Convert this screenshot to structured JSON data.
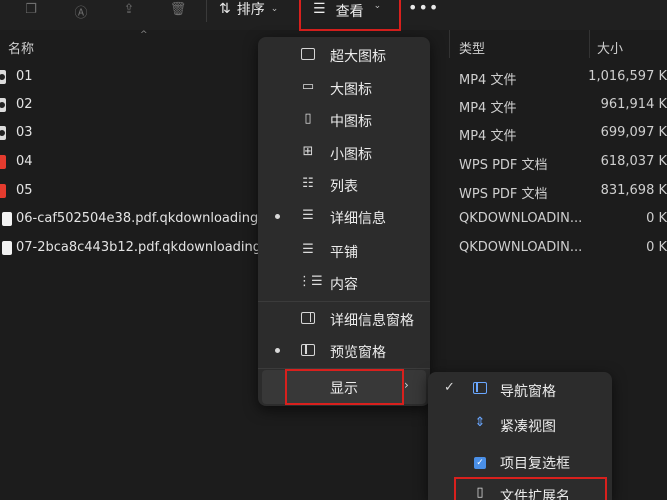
{
  "toolbar": {
    "sort_label": "排序",
    "view_label": "查看",
    "more": "•••"
  },
  "columns": {
    "name": "名称",
    "type": "类型",
    "size": "大小"
  },
  "files": [
    {
      "name": "01",
      "type": "MP4 文件",
      "size": "1,016,597 K",
      "icon": "video"
    },
    {
      "name": "02",
      "type": "MP4 文件",
      "size": "961,914 K",
      "icon": "video"
    },
    {
      "name": "03",
      "type": "MP4 文件",
      "size": "699,097 K",
      "icon": "video"
    },
    {
      "name": "04",
      "type": "WPS PDF 文档",
      "size": "618,037 K",
      "icon": "pdf"
    },
    {
      "name": "05",
      "type": "WPS PDF 文档",
      "size": "831,698 K",
      "icon": "pdf"
    },
    {
      "name": "06-caf502504e38.pdf.qkdownloading",
      "type": "QKDOWNLOADIN...",
      "size": "0 K",
      "icon": "blank"
    },
    {
      "name": "07-2bca8c443b12.pdf.qkdownloading",
      "type": "QKDOWNLOADIN...",
      "size": "0 K",
      "icon": "blank"
    }
  ],
  "view_menu": {
    "items": [
      {
        "label": "超大图标",
        "icon": "xl-icons-icon",
        "selected": false
      },
      {
        "label": "大图标",
        "icon": "large-icons-icon",
        "selected": false
      },
      {
        "label": "中图标",
        "icon": "medium-icons-icon",
        "selected": false
      },
      {
        "label": "小图标",
        "icon": "small-icons-icon",
        "selected": false
      },
      {
        "label": "列表",
        "icon": "list-icon",
        "selected": false
      },
      {
        "label": "详细信息",
        "icon": "details-icon",
        "selected": true
      },
      {
        "label": "平铺",
        "icon": "tiles-icon",
        "selected": false
      },
      {
        "label": "内容",
        "icon": "content-icon",
        "selected": false
      }
    ],
    "panes": [
      {
        "label": "详细信息窗格",
        "icon": "details-pane-icon",
        "selected": false
      },
      {
        "label": "预览窗格",
        "icon": "preview-pane-icon",
        "selected": true
      }
    ],
    "show_label": "显示"
  },
  "show_submenu": {
    "items": [
      {
        "label": "导航窗格",
        "checked": true,
        "icon": "nav-pane-icon"
      },
      {
        "label": "紧凑视图",
        "checked": false,
        "icon": "compact-view-icon"
      },
      {
        "label": "项目复选框",
        "checked": false,
        "icon": "item-checkbox-icon"
      },
      {
        "label": "文件扩展名",
        "checked": false,
        "icon": "file-extension-icon"
      }
    ]
  },
  "colors": {
    "highlight": "#d8201d",
    "menu_bg": "#2c2c2c",
    "window_bg": "#1c1c1c"
  }
}
